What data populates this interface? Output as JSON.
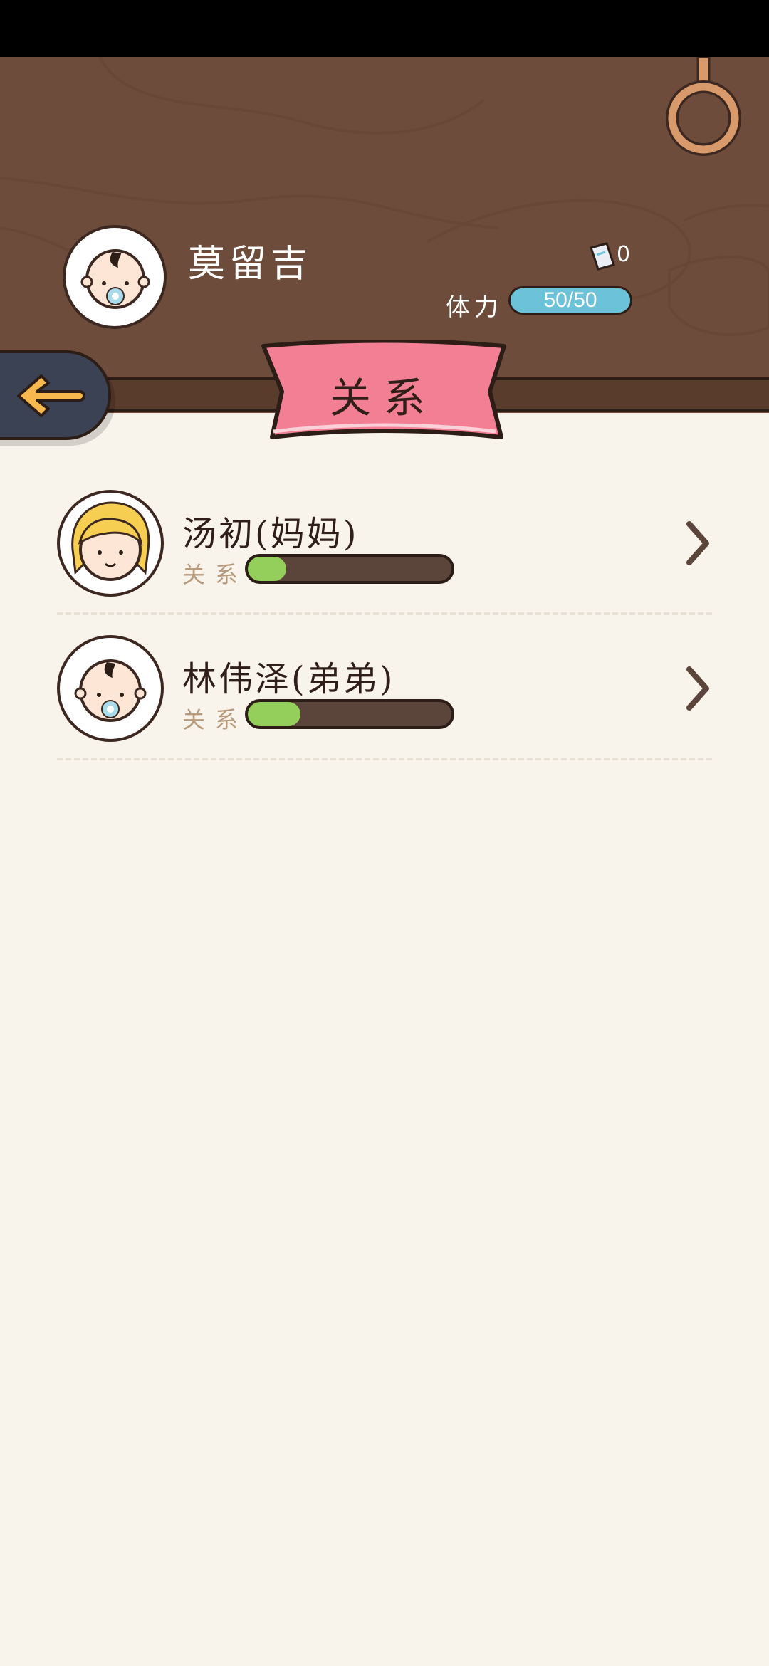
{
  "player": {
    "name": "莫留吉",
    "currency_value": "0",
    "stamina_label": "体力",
    "stamina_text": "50/50",
    "stamina_fraction": 1.0
  },
  "page_title": "关系",
  "relations": [
    {
      "name": "汤初(妈妈)",
      "relation_label": "关系",
      "relation_fraction": 0.19,
      "avatar": "blonde-girl-avatar"
    },
    {
      "name": "林伟泽(弟弟)",
      "relation_label": "关系",
      "relation_fraction": 0.26,
      "avatar": "baby-boy-avatar"
    }
  ],
  "colors": {
    "header_wood": "#6e4c3b",
    "background": "#f8f4ec",
    "ribbon": "#f27f93",
    "stamina": "#6cc2d8",
    "relation_fill": "#93cf5a",
    "back_button": "#3b4254",
    "back_arrow": "#f7b84d"
  },
  "icons": [
    "back-arrow-icon",
    "ring-icon",
    "currency-ticket-icon",
    "chevron-right-icon"
  ]
}
